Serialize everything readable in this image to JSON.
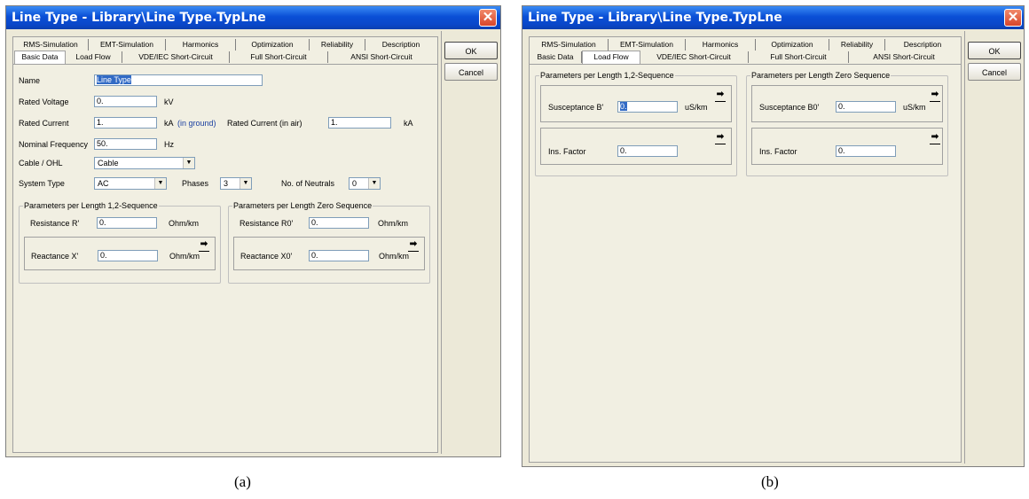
{
  "windows": [
    {
      "title": "Line Type - Library\\Line Type.TypLne",
      "tabs_row1": [
        "RMS-Simulation",
        "EMT-Simulation",
        "Harmonics",
        "Optimization",
        "Reliability",
        "Description"
      ],
      "tabs_row2": [
        "Basic Data",
        "Load Flow",
        "VDE/IEC Short-Circuit",
        "Full Short-Circuit",
        "ANSI Short-Circuit"
      ],
      "active_tab": "Basic Data",
      "ok_label": "OK",
      "cancel_label": "Cancel",
      "close_glyph": "✕",
      "caption": "(a)",
      "basic": {
        "name_label": "Name",
        "name_value": "Line Type",
        "rated_voltage_label": "Rated Voltage",
        "rated_voltage_value": "0.",
        "rated_voltage_unit": "kV",
        "rated_current_label": "Rated Current",
        "rated_current_value": "1.",
        "rated_current_unit": "kA",
        "in_ground": "(in ground)",
        "rated_current_air_label": "Rated Current (in air)",
        "rated_current_air_value": "1.",
        "rated_current_air_unit": "kA",
        "nominal_freq_label": "Nominal Frequency",
        "nominal_freq_value": "50.",
        "nominal_freq_unit": "Hz",
        "cable_ohl_label": "Cable / OHL",
        "cable_ohl_value": "Cable",
        "system_type_label": "System Type",
        "system_type_value": "AC",
        "phases_label": "Phases",
        "phases_value": "3",
        "neutrals_label": "No. of Neutrals",
        "neutrals_value": "0",
        "group_pos_title": "Parameters per Length 1,2-Sequence",
        "group_zero_title": "Parameters per Length Zero Sequence",
        "resistance_r_label": "Resistance R'",
        "resistance_r_value": "0.",
        "resistance_r_unit": "Ohm/km",
        "reactance_x_label": "Reactance X'",
        "reactance_x_value": "0.",
        "reactance_x_unit": "Ohm/km",
        "resistance_r0_label": "Resistance R0'",
        "resistance_r0_value": "0.",
        "resistance_r0_unit": "Ohm/km",
        "reactance_x0_label": "Reactance X0'",
        "reactance_x0_value": "0.",
        "reactance_x0_unit": "Ohm/km"
      }
    },
    {
      "title": "Line Type - Library\\Line Type.TypLne",
      "tabs_row1": [
        "RMS-Simulation",
        "EMT-Simulation",
        "Harmonics",
        "Optimization",
        "Reliability",
        "Description"
      ],
      "tabs_row2": [
        "Basic Data",
        "Load Flow",
        "VDE/IEC Short-Circuit",
        "Full Short-Circuit",
        "ANSI Short-Circuit"
      ],
      "active_tab": "Load Flow",
      "ok_label": "OK",
      "cancel_label": "Cancel",
      "close_glyph": "✕",
      "caption": "(b)",
      "loadflow": {
        "group_pos_title": "Parameters per Length 1,2-Sequence",
        "group_zero_title": "Parameters per Length Zero Sequence",
        "susceptance_b_label": "Susceptance B'",
        "susceptance_b_value": "0.",
        "susceptance_b_unit": "uS/km",
        "ins_factor_label": "Ins. Factor",
        "ins_factor_value": "0.",
        "susceptance_b0_label": "Susceptance B0'",
        "susceptance_b0_value": "0.",
        "susceptance_b0_unit": "uS/km",
        "ins_factor0_label": "Ins. Factor",
        "ins_factor0_value": "0."
      }
    }
  ],
  "icons": {
    "arrow": "➡",
    "dropdown": "▼"
  }
}
